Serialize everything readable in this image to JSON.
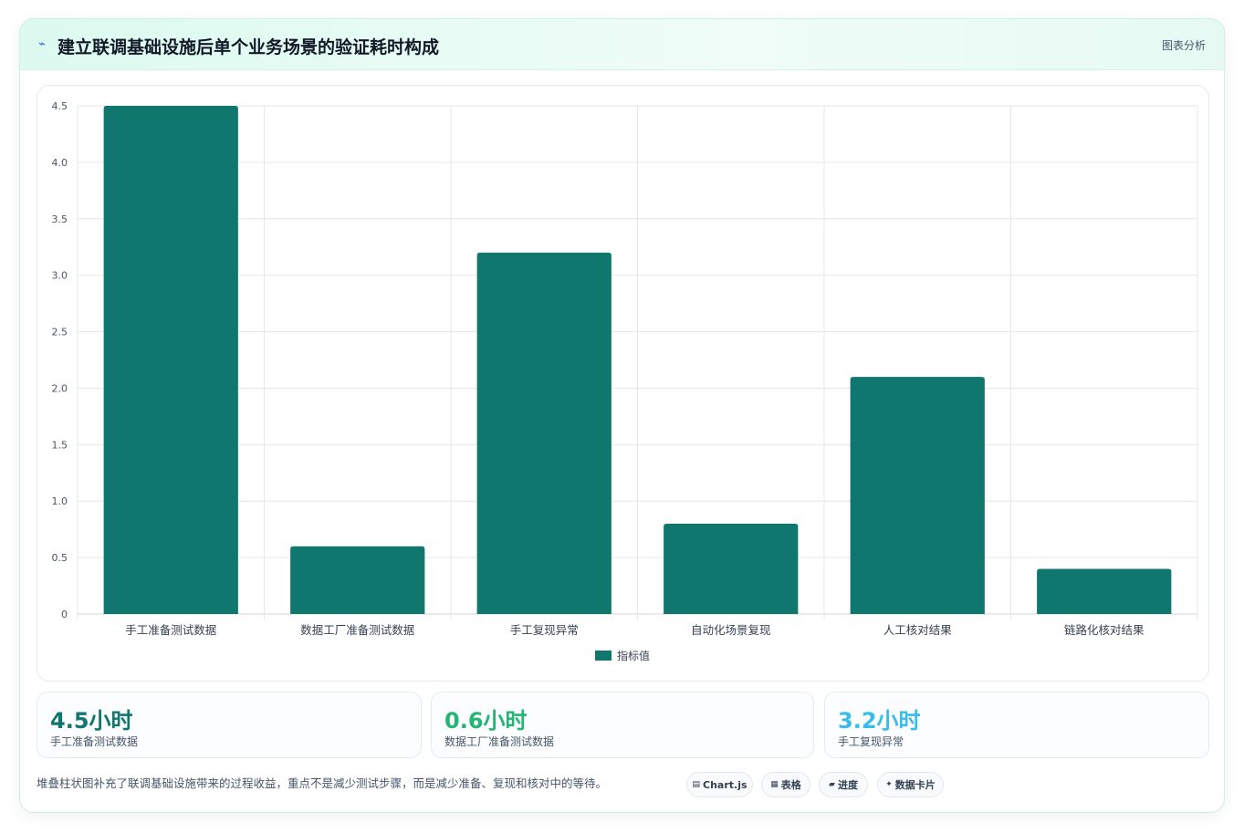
{
  "header": {
    "icon": "lightning-icon",
    "title": "建立联调基础设施后单个业务场景的验证耗时构成",
    "tag": "图表分析"
  },
  "chart_data": {
    "type": "bar",
    "categories": [
      "手工准备测试数据",
      "数据工厂准备测试数据",
      "手工复现异常",
      "自动化场景复现",
      "人工核对结果",
      "链路化核对结果"
    ],
    "series": [
      {
        "name": "指标值",
        "values": [
          4.5,
          0.6,
          3.2,
          0.8,
          2.1,
          0.4
        ],
        "color": "#10776e"
      }
    ],
    "ylim": [
      0,
      4.5
    ],
    "yticks": [
      "0",
      "0.5",
      "1.0",
      "1.5",
      "2.0",
      "2.5",
      "3.0",
      "3.5",
      "4.0",
      "4.5"
    ],
    "grid": true,
    "legend": "bottom-center"
  },
  "stats": [
    {
      "value": "4.5小时",
      "label": "手工准备测试数据",
      "color": "#10776e"
    },
    {
      "value": "0.6小时",
      "label": "数据工厂准备测试数据",
      "color": "#22b573"
    },
    {
      "value": "3.2小时",
      "label": "手工复现异常",
      "color": "#38bde8"
    }
  ],
  "note": "堆叠柱状图补充了联调基础设施带来的过程收益，重点不是减少测试步骤，而是减少准备、复现和核对中的等待。",
  "pills": [
    {
      "icon": "▤",
      "label": "Chart.js"
    },
    {
      "icon": "▦",
      "label": "表格"
    },
    {
      "icon": "▰",
      "label": "进度"
    },
    {
      "icon": "✦",
      "label": "数据卡片"
    }
  ]
}
